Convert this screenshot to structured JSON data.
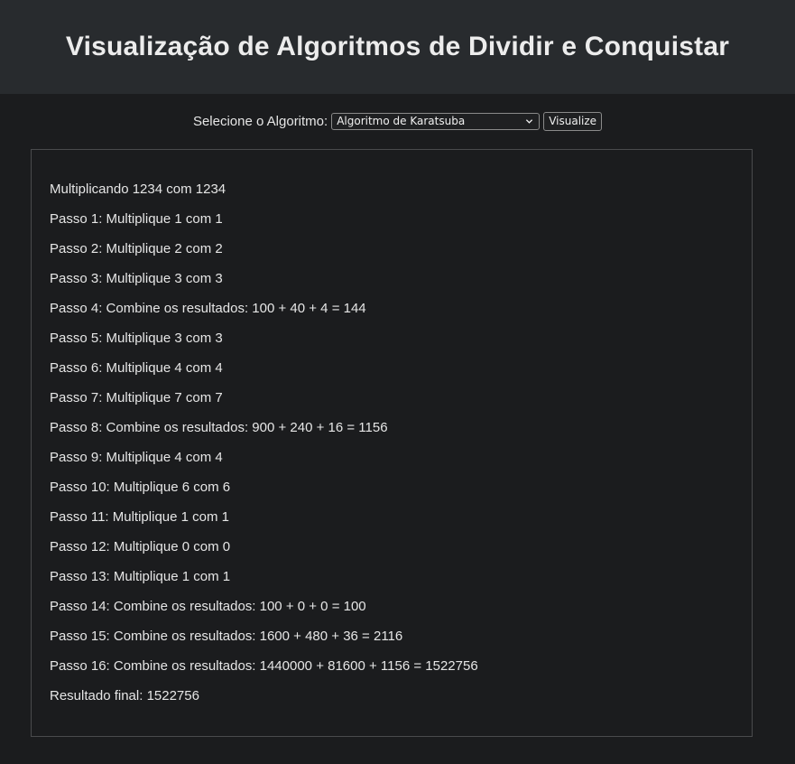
{
  "header": {
    "title": "Visualização de Algoritmos de Dividir e Conquistar"
  },
  "controls": {
    "label": "Selecione o Algoritmo:",
    "selected_algorithm": "Algoritmo de Karatsuba",
    "visualize_label": "Visualize"
  },
  "output": {
    "lines": [
      "Multiplicando 1234 com 1234",
      "Passo 1: Multiplique 1 com 1",
      "Passo 2: Multiplique 2 com 2",
      "Passo 3: Multiplique 3 com 3",
      "Passo 4: Combine os resultados: 100 + 40 + 4 = 144",
      "Passo 5: Multiplique 3 com 3",
      "Passo 6: Multiplique 4 com 4",
      "Passo 7: Multiplique 7 com 7",
      "Passo 8: Combine os resultados: 900 + 240 + 16 = 1156",
      "Passo 9: Multiplique 4 com 4",
      "Passo 10: Multiplique 6 com 6",
      "Passo 11: Multiplique 1 com 1",
      "Passo 12: Multiplique 0 com 0",
      "Passo 13: Multiplique 1 com 1",
      "Passo 14: Combine os resultados: 100 + 0 + 0 = 100",
      "Passo 15: Combine os resultados: 1600 + 480 + 36 = 2116",
      "Passo 16: Combine os resultados: 1440000 + 81600 + 1156 = 1522756",
      "Resultado final: 1522756"
    ]
  },
  "icons": {
    "select_chevron": "chevron-down-icon"
  }
}
